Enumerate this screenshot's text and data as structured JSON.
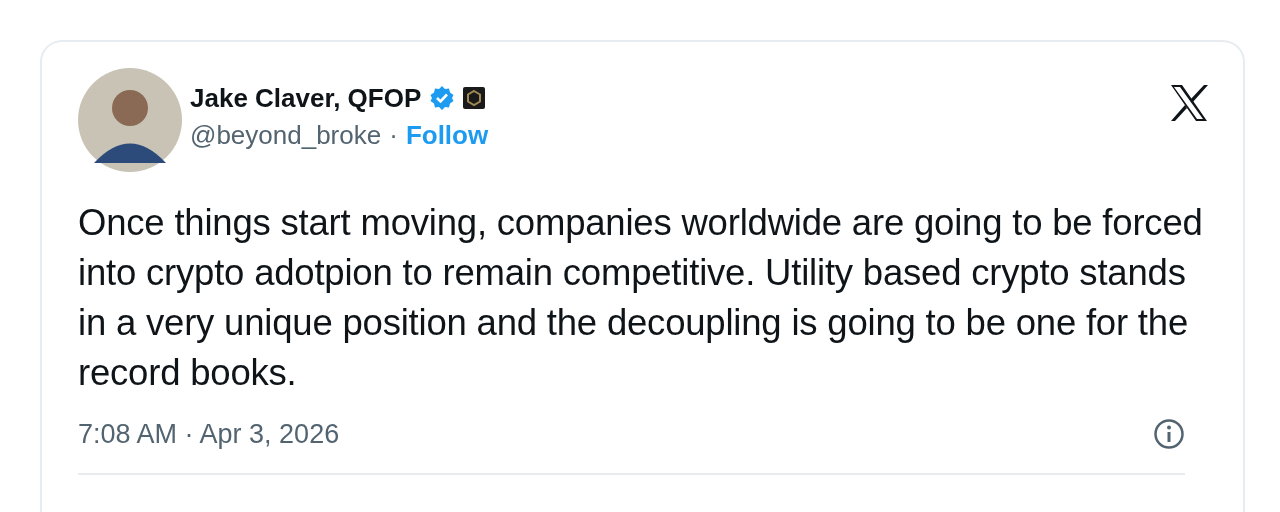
{
  "author": {
    "name": "Jake Claver, QFOP",
    "verified": true,
    "handle": "@beyond_broke",
    "separator": "·",
    "follow": "Follow"
  },
  "text": "Once things start moving, companies worldwide are going to be forced into crypto adotpion to remain competitive. Utility based crypto stands in a very unique position and the decoupling is going to be one for the record books.",
  "timestamp": "7:08 AM · Apr 3, 2026"
}
